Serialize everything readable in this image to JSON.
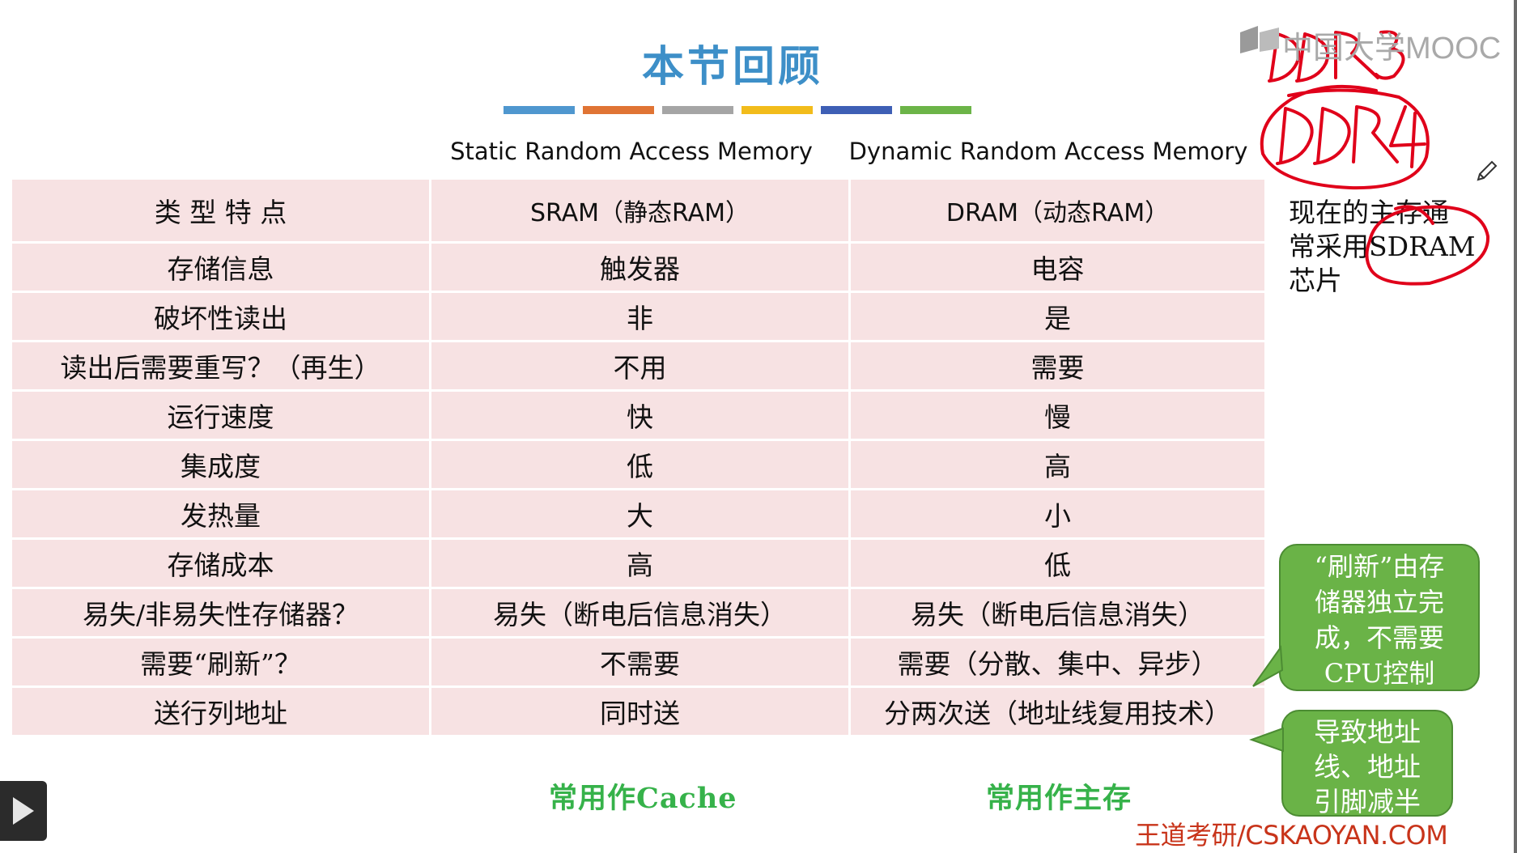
{
  "slide": {
    "title": "本节回顾",
    "bar_colors": [
      "#4f97cf",
      "#e07434",
      "#a5a5a5",
      "#f2bc1b",
      "#3e5fb5",
      "#6cb448"
    ],
    "col_headers": {
      "sram": "Static Random Access Memory",
      "dram": "Dynamic Random Access Memory"
    },
    "table": {
      "header": [
        "类 型 特 点",
        "SRAM（静态RAM）",
        "DRAM（动态RAM）"
      ],
      "rows": [
        [
          "存储信息",
          "触发器",
          "电容"
        ],
        [
          "破坏性读出",
          "非",
          "是"
        ],
        [
          "读出后需要重写？（再生）",
          "不用",
          "需要"
        ],
        [
          "运行速度",
          "快",
          "慢"
        ],
        [
          "集成度",
          "低",
          "高"
        ],
        [
          "发热量",
          "大",
          "小"
        ],
        [
          "存储成本",
          "高",
          "低"
        ],
        [
          "易失/非易失性存储器？",
          "易失（断电后信息消失）",
          "易失（断电后信息消失）"
        ],
        [
          "需要“刷新”？",
          "不需要",
          "需要（分散、集中、异步）"
        ],
        [
          "送行列地址",
          "同时送",
          "分两次送（地址线复用技术）"
        ]
      ]
    },
    "note": {
      "lines": [
        "现在的主存通",
        "常采用SDRAM",
        "芯片"
      ]
    },
    "callout_refresh": {
      "lines": [
        "“刷新”由存",
        "储器独立完",
        "成，不需要",
        "CPU控制"
      ]
    },
    "callout_address": {
      "lines": [
        "导致地址",
        "线、地址",
        "引脚减半"
      ]
    },
    "footer": {
      "sram_use": "常用作Cache",
      "dram_use": "常用作主存"
    },
    "brand": "王道考研/CSKAOYAN.COM",
    "watermark": "中国大学MOOC",
    "handwriting": [
      "DDR3",
      "DDR4"
    ]
  }
}
